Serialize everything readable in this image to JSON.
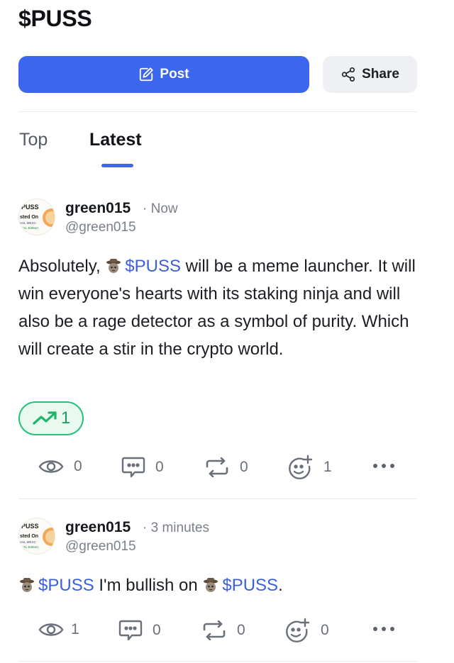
{
  "page": {
    "title": "$PUSS"
  },
  "actions": {
    "post_label": "Post",
    "share_label": "Share"
  },
  "tabs": [
    {
      "label": "Top",
      "active": false
    },
    {
      "label": "Latest",
      "active": true
    }
  ],
  "colors": {
    "accent": "#3c66ee",
    "trend_green": "#28c27a",
    "cashtag": "#3b5fe0"
  },
  "posts": [
    {
      "author": "green015",
      "time": "· Now",
      "handle": "@green015",
      "text_parts": [
        "Absolutely, ",
        "$PUSS",
        " will be a meme launcher. It will win everyone's hearts with its staking ninja and will also be a rage detector as a symbol of purity. Which will create a stir in the crypto world."
      ],
      "trend_count": "1",
      "stats": {
        "views": "0",
        "comments": "0",
        "reposts": "0",
        "reactions": "1"
      }
    },
    {
      "author": "green015",
      "time": "· 3 minutes",
      "handle": "@green015",
      "text_parts": [
        "$PUSS",
        " I'm bullish on ",
        "$PUSS",
        "."
      ],
      "stats": {
        "views": "1",
        "comments": "0",
        "reposts": "0",
        "reactions": "0"
      }
    }
  ],
  "avatar_text": {
    "line1": "PUSS",
    "line2": "sted On",
    "line3": "ens, MEXC",
    "line4": "XXL BitMart"
  }
}
